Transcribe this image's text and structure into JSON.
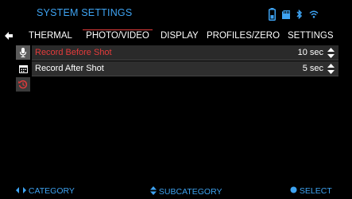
{
  "header": {
    "title": "SYSTEM SETTINGS"
  },
  "status_icons": [
    "battery-icon",
    "sd-card-icon",
    "bluetooth-icon",
    "wifi-icon"
  ],
  "tabs": [
    {
      "label": "THERMAL",
      "active": false
    },
    {
      "label": "PHOTO/VIDEO",
      "active": true
    },
    {
      "label": "DISPLAY",
      "active": false
    },
    {
      "label": "PROFILES/ZERO",
      "active": false
    },
    {
      "label": "SETTINGS",
      "active": false
    }
  ],
  "sidebar": [
    "microphone-icon",
    "calendar-icon",
    "history-icon"
  ],
  "settings": [
    {
      "label": "Record Before Shot",
      "value": "10 sec",
      "selected": true
    },
    {
      "label": "Record After Shot",
      "value": "5 sec",
      "selected": false
    }
  ],
  "footer": {
    "category": "CATEGORY",
    "subcategory": "SUBCATEGORY",
    "select": "SELECT"
  },
  "colors": {
    "accent": "#3ea3f2",
    "highlight": "#e53b3b",
    "background": "#000000"
  }
}
